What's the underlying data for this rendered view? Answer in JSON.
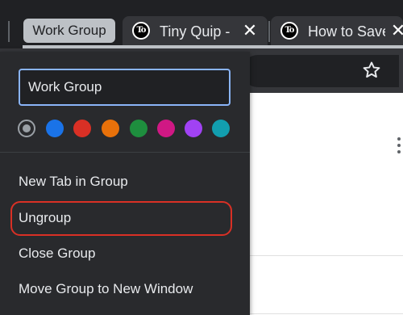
{
  "tabstrip": {
    "group_label": "Work Group",
    "tabs": [
      {
        "title": "Tiny Quip -",
        "favicon": "To",
        "close": "✕"
      },
      {
        "title": "How to Save",
        "favicon": "To",
        "close": "✕"
      }
    ]
  },
  "toolbar": {
    "bookmark_icon": "star-icon"
  },
  "group_editor": {
    "name_value": "Work Group",
    "colors": [
      "#9aa0a6",
      "#1a73e8",
      "#d93025",
      "#e8710a",
      "#1e8e3e",
      "#d01884",
      "#a142f4",
      "#129eaf"
    ],
    "selected_color_index": 0,
    "menu": [
      {
        "label": "New Tab in Group"
      },
      {
        "label": "Ungroup"
      },
      {
        "label": "Close Group"
      },
      {
        "label": "Move Group to New Window"
      }
    ],
    "highlight_color": "#d93025"
  }
}
